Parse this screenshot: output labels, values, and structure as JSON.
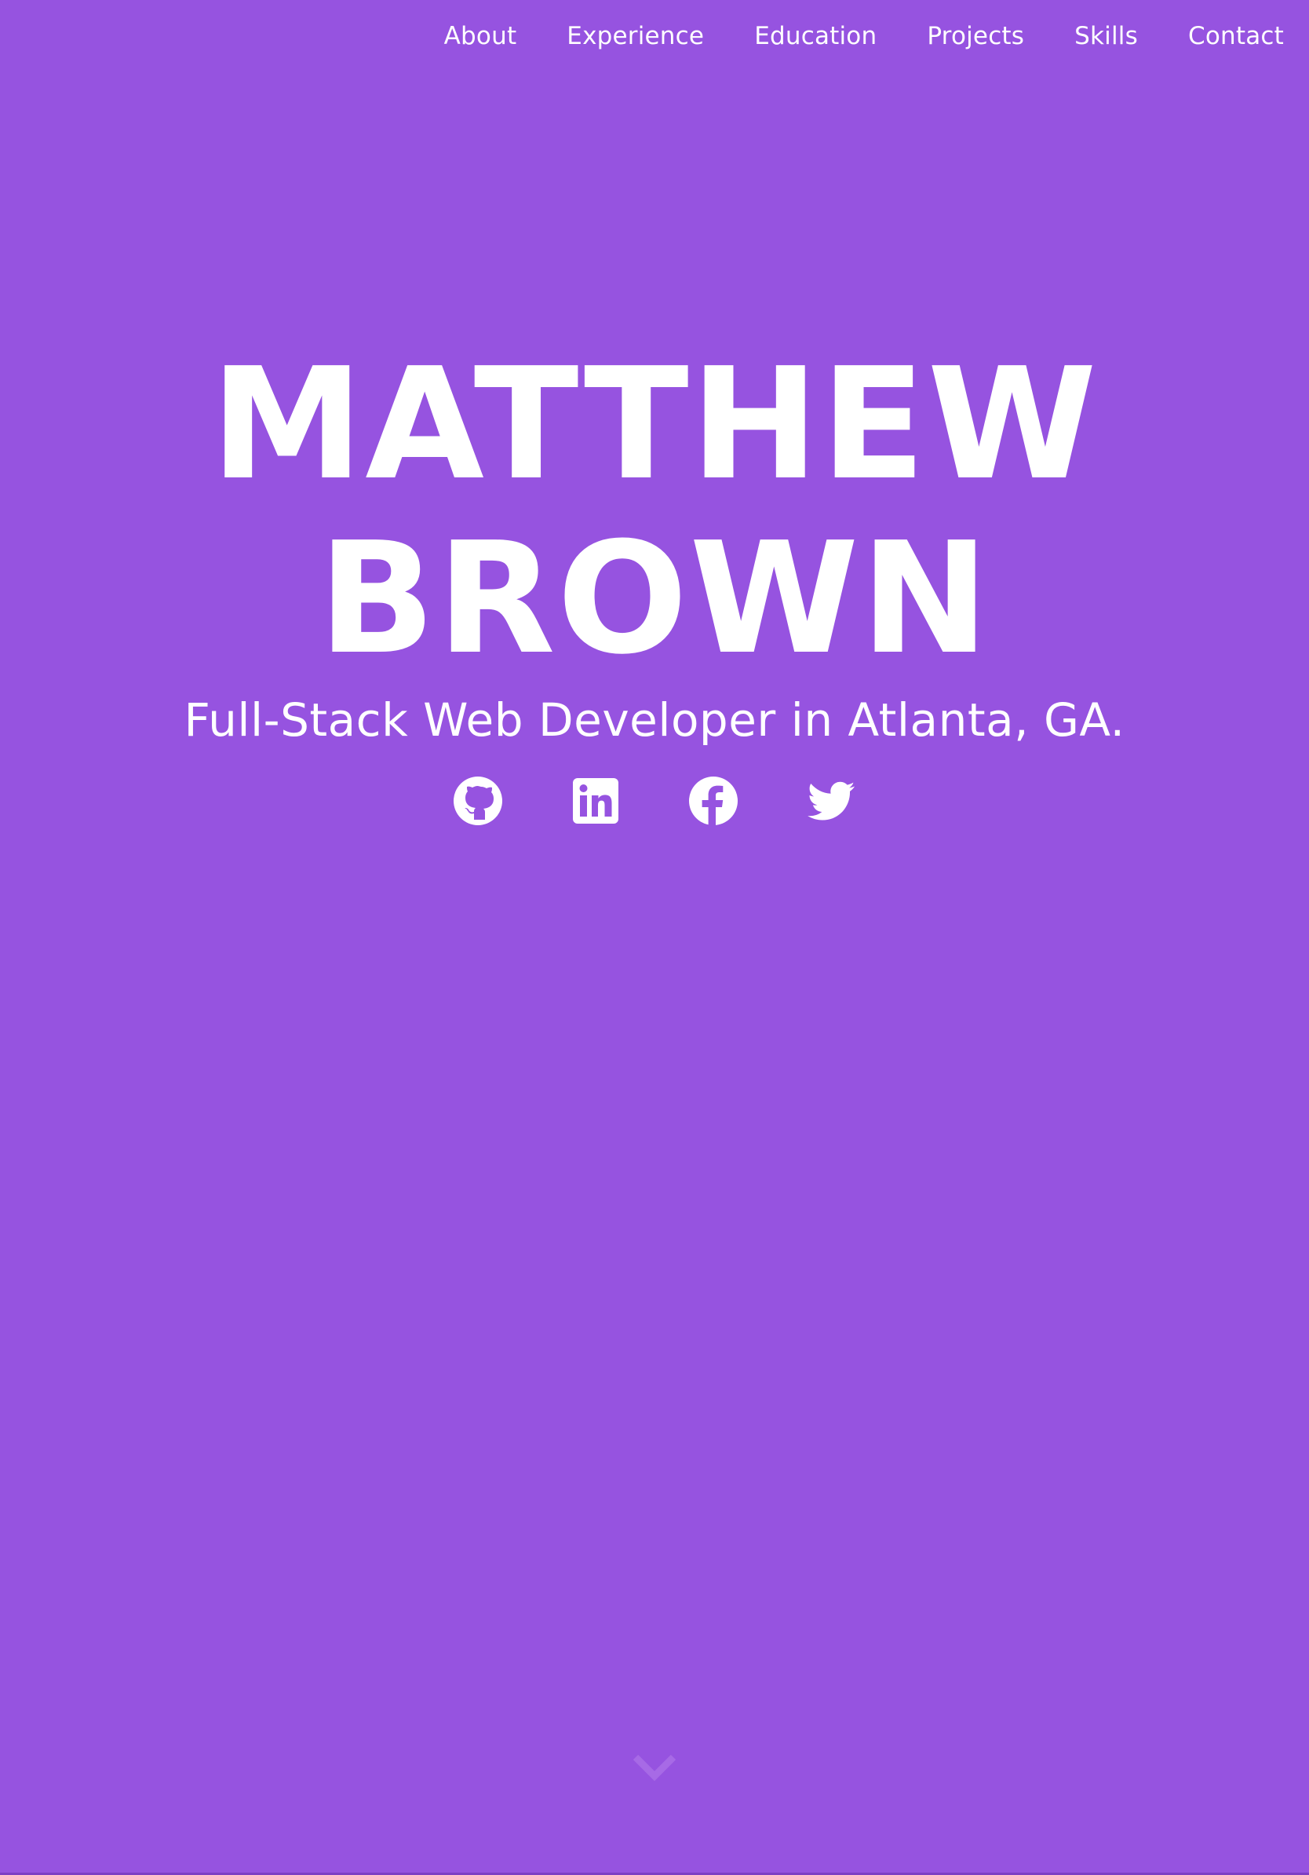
{
  "colors": {
    "background": "#9653e0",
    "text": "#ffffff",
    "scroll_arrow": "#a76ae6"
  },
  "nav": {
    "items": [
      {
        "label": "About"
      },
      {
        "label": "Experience"
      },
      {
        "label": "Education"
      },
      {
        "label": "Projects"
      },
      {
        "label": "Skills"
      },
      {
        "label": "Contact"
      }
    ]
  },
  "hero": {
    "first_name": "MATTHEW",
    "last_name": "BROWN",
    "subtitle": "Full-Stack Web Developer in Atlanta, GA."
  },
  "social": {
    "icons": [
      "github-icon",
      "linkedin-icon",
      "facebook-icon",
      "twitter-icon"
    ]
  },
  "scroll": {
    "icon": "chevron-down-icon"
  }
}
